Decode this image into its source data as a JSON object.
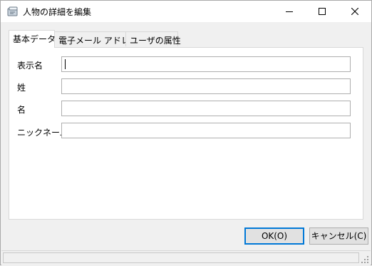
{
  "window": {
    "title": "人物の詳細を編集",
    "minimize_icon": "minimize-icon",
    "maximize_icon": "maximize-icon",
    "close_icon": "close-icon"
  },
  "tabs": [
    {
      "label": "基本データ",
      "active": true
    },
    {
      "label": "電子メール アドレス",
      "active": false
    },
    {
      "label": "ユーザの属性",
      "active": false
    }
  ],
  "form": {
    "display_name": {
      "label": "表示名",
      "value": ""
    },
    "last_name": {
      "label": "姓",
      "value": ""
    },
    "first_name": {
      "label": "名",
      "value": ""
    },
    "nickname": {
      "label": "ニックネーム",
      "value": ""
    }
  },
  "buttons": {
    "ok": "OK(O)",
    "cancel": "キャンセル(C)"
  },
  "colors": {
    "accent": "#0078d7",
    "window_bg": "#f0f0f0",
    "panel_bg": "#ffffff"
  }
}
